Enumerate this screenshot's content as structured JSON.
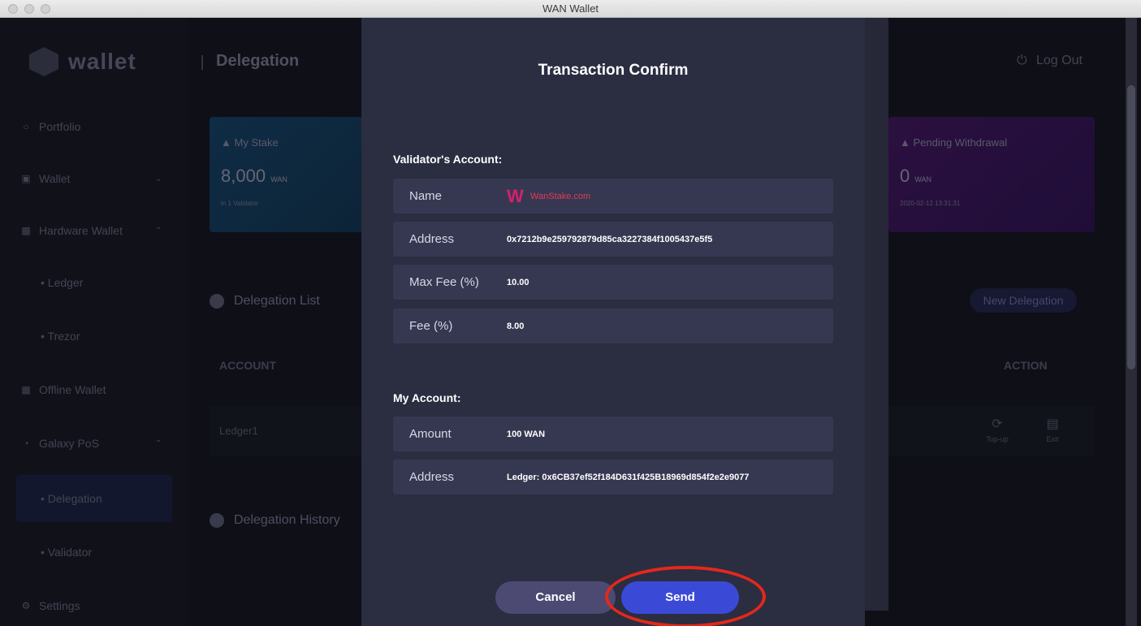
{
  "window": {
    "title": "WAN Wallet"
  },
  "sidebar": {
    "logo_text": "wallet",
    "items": [
      {
        "label": "Portfolio",
        "icon": "portfolio-icon"
      },
      {
        "label": "Wallet",
        "icon": "wallet-icon"
      },
      {
        "label": "Hardware Wallet",
        "icon": "hardware-wallet-icon"
      },
      {
        "label": "Ledger"
      },
      {
        "label": "Trezor"
      },
      {
        "label": "Offline Wallet",
        "icon": "offline-wallet-icon"
      },
      {
        "label": "Galaxy PoS",
        "icon": "galaxy-pos-icon"
      },
      {
        "label": "Delegation"
      },
      {
        "label": "Validator"
      },
      {
        "label": "Settings",
        "icon": "settings-icon"
      }
    ]
  },
  "header": {
    "title": "Delegation",
    "logout_label": "Log Out"
  },
  "cards": {
    "my_stake": {
      "label": "My Stake",
      "value": "8,000",
      "unit": "WAN",
      "sub": "in 1 Validator"
    },
    "pending_withdrawal": {
      "label": "Pending Withdrawal",
      "value": "0",
      "unit": "WAN",
      "sub": "2020-02-12 13:31:31"
    }
  },
  "delegation_list": {
    "title": "Delegation List",
    "new_button": "New Delegation",
    "columns": {
      "account": "ACCOUNT",
      "action": "ACTION"
    },
    "rows": [
      {
        "account": "Ledger1"
      }
    ],
    "actions": {
      "topup": "Top-up",
      "exit": "Exit"
    }
  },
  "delegation_history": {
    "title": "Delegation History"
  },
  "dialog": {
    "title": "Transaction Confirm",
    "validator_section": "Validator's Account:",
    "validator": {
      "name_label": "Name",
      "name_value": "WanStake.com",
      "address_label": "Address",
      "address_value": "0x7212b9e259792879d85ca3227384f1005437e5f5",
      "max_fee_label": "Max Fee (%)",
      "max_fee_value": "10.00",
      "fee_label": "Fee (%)",
      "fee_value": "8.00"
    },
    "my_section": "My Account:",
    "my_account": {
      "amount_label": "Amount",
      "amount_value": "100 WAN",
      "address_label": "Address",
      "address_value": "Ledger: 0x6CB37ef52f184D631f425B18969d854f2e2e9077"
    },
    "cancel_label": "Cancel",
    "send_label": "Send"
  },
  "colors": {
    "send_button": "#3b4ad6",
    "highlight_ring": "#e2281b",
    "validator_brand": "#d6206e"
  }
}
